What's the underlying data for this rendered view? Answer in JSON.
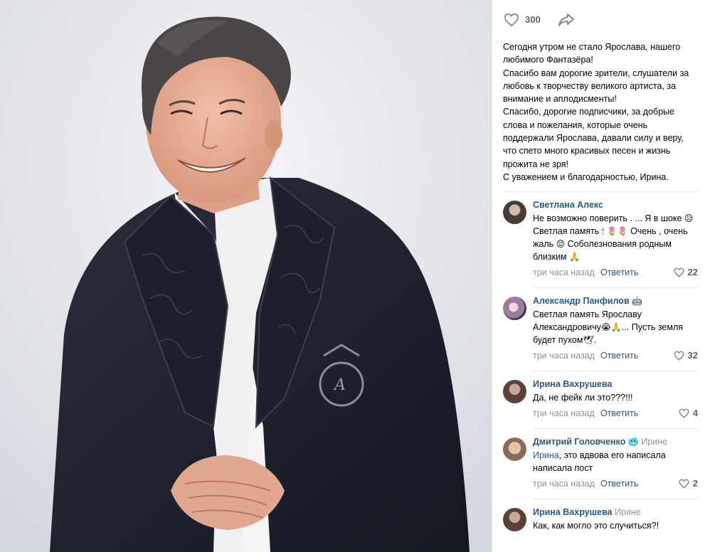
{
  "post": {
    "likes": "300",
    "lines": [
      "Сегодня утром не стало Ярослава, нашего любимого Фантазёра!",
      "Спасибо вам дорогие зрители, слушатели за любовь к творчеству великого артиста, за внимание и аплодисменты!",
      "Спасибо, дорогие подписчики, за добрые слова и пожелания, которые очень поддержали Ярослава, давали силу и веру, что спето много красивых песен и жизнь прожита не зря!",
      "С уважением и благодарностью, Ирина."
    ]
  },
  "comments": [
    {
      "author": "Светлана Алекс",
      "reply_to": "",
      "text_a": "Не возможно поверить . ... Я в шоке ",
      "text_b": "Светлая память ",
      "text_c": " Очень , очень жаль ",
      "text_d": " Соболезнования родным близким ",
      "time": "три часа назад",
      "reply_label": "Ответить",
      "likes": "22"
    },
    {
      "author": "Александр Панфилов",
      "reply_to": "",
      "text_a": "Светлая память Ярославу Александровичу",
      "text_b": "... Пусть земля будет пухом",
      "text_c": ".",
      "time": "три часа назад",
      "reply_label": "Ответить",
      "likes": "32"
    },
    {
      "author": "Ирина Вахрушева",
      "reply_to": "",
      "text_a": "Да, не фейк ли это???!!!",
      "time": "три часа назад",
      "reply_label": "Ответить",
      "likes": "4"
    },
    {
      "author": "Дмитрий Головченко",
      "reply_to": "Ирине",
      "mention": "Ирина",
      "text_a": ", это вдвова его написала написала пост",
      "time": "три часа назад",
      "reply_label": "Ответить",
      "likes": "2"
    },
    {
      "author": "Ирина Вахрушева",
      "reply_to": "Ирине",
      "text_a": "Как, как могло это случиться?!"
    }
  ],
  "colors": {
    "link": "#2a5885",
    "meta": "#939393",
    "divider": "#e7e8ec"
  },
  "icons": [
    "heart-icon",
    "share-arrow-icon",
    "heart-outline-icon"
  ]
}
